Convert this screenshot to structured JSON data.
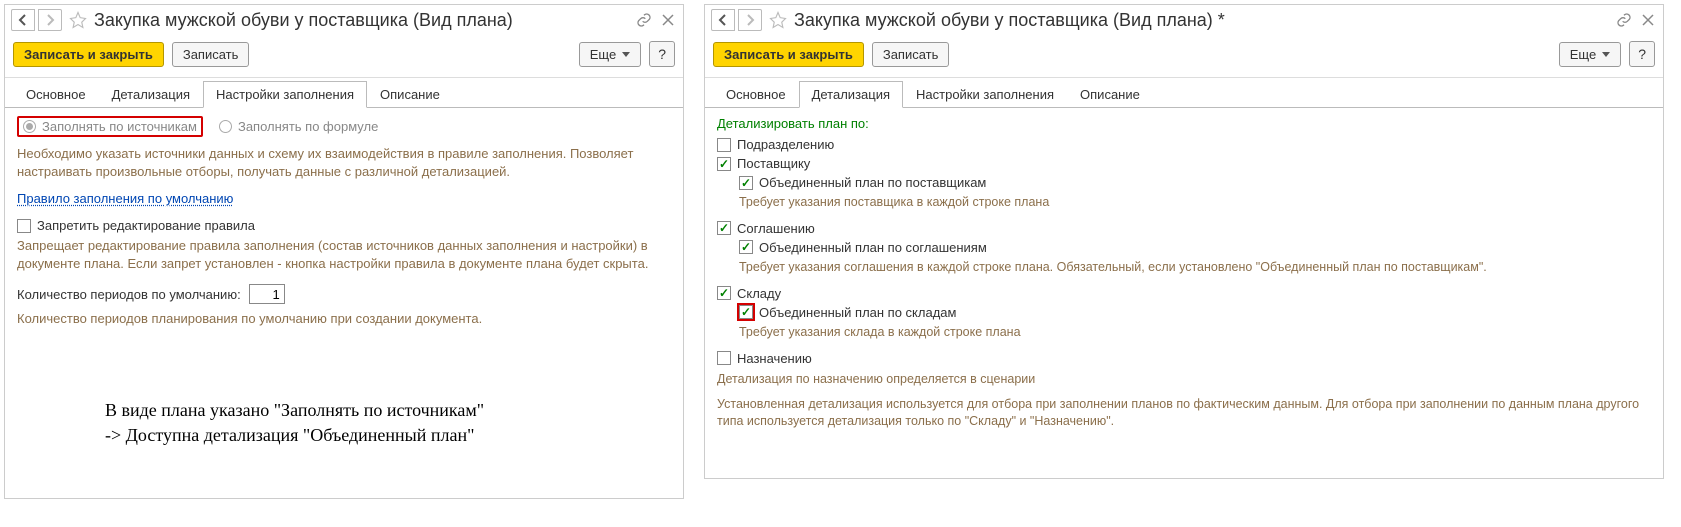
{
  "left": {
    "title": "Закупка мужской обуви у поставщика (Вид плана)",
    "toolbar": {
      "save_close": "Записать и закрыть",
      "save": "Записать",
      "more": "Еще",
      "help": "?"
    },
    "tabs": [
      "Основное",
      "Детализация",
      "Настройки заполнения",
      "Описание"
    ],
    "active_tab": 2,
    "radio": {
      "by_sources": "Заполнять по источникам",
      "by_formula": "Заполнять по формуле"
    },
    "radio_desc": "Необходимо указать источники данных и схему их взаимодействия в правиле заполнения. Позволяет настраивать произвольные отборы, получать данные с различной детализацией.",
    "default_rule_link": "Правило заполнения по умолчанию",
    "forbid_edit_label": "Запретить редактирование правила",
    "forbid_edit_desc": "Запрещает редактирование правила заполнения (состав источников данных заполнения и настройки) в документе плана. Если запрет установлен - кнопка настройки правила в документе плана будет скрыта.",
    "periods_label": "Количество периодов по умолчанию:",
    "periods_value": "1",
    "periods_desc": "Количество периодов планирования по умолчанию при создании документа.",
    "annot_l1": "В виде плана указано \"Заполнять по источникам\"",
    "annot_l2": "-> Доступна детализация \"Объединенный план\""
  },
  "right": {
    "title": "Закупка мужской обуви у поставщика (Вид плана) *",
    "toolbar": {
      "save_close": "Записать и закрыть",
      "save": "Записать",
      "more": "Еще",
      "help": "?"
    },
    "tabs": [
      "Основное",
      "Детализация",
      "Настройки заполнения",
      "Описание"
    ],
    "active_tab": 1,
    "section_title": "Детализировать план по:",
    "items": {
      "dept": "Подразделению",
      "supplier": "Поставщику",
      "supplier_sub": "Объединенный план по поставщикам",
      "supplier_hint": "Требует указания поставщика в каждой строке плана",
      "agreement": "Соглашению",
      "agreement_sub": "Объединенный план по соглашениям",
      "agreement_hint": "Требует указания соглашения в каждой строке плана. Обязательный, если установлено \"Объединенный план по поставщикам\".",
      "warehouse": "Складу",
      "warehouse_sub": "Объединенный план по складам",
      "warehouse_hint": "Требует указания склада в каждой строке плана",
      "purpose": "Назначению",
      "purpose_hint": "Детализация по назначению определяется в сценарии"
    },
    "footer": "Установленная детализация используется для отбора при заполнении планов по фактическим данным. Для отбора при заполнении по данным плана другого типа используется детализация только по \"Складу\" и \"Назначению\"."
  }
}
